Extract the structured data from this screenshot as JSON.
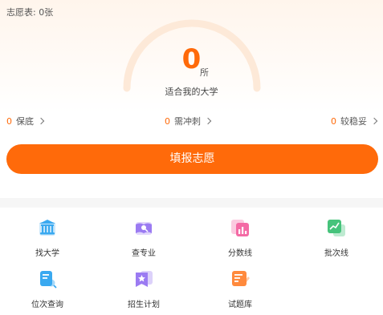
{
  "header": {
    "count_label": "志愿表:",
    "count_value": "0张"
  },
  "summary": {
    "number": "0",
    "unit": "所",
    "caption": "适合我的大学"
  },
  "stats": [
    {
      "value": "0",
      "label": "保底"
    },
    {
      "value": "0",
      "label": "需冲刺"
    },
    {
      "value": "0",
      "label": "较稳妥"
    }
  ],
  "main_button": "填报志愿",
  "grid": [
    {
      "label": "找大学",
      "icon": "university-icon",
      "color": "#3aa9f0"
    },
    {
      "label": "查专业",
      "icon": "book-icon",
      "color": "#9b7bf2"
    },
    {
      "label": "分数线",
      "icon": "bar-chart-icon",
      "color": "#f46aa5"
    },
    {
      "label": "批次线",
      "icon": "trend-chart-icon",
      "color": "#46c37b"
    },
    {
      "label": "位次查询",
      "icon": "document-search-icon",
      "color": "#3aa9f0"
    },
    {
      "label": "招生计划",
      "icon": "star-flag-icon",
      "color": "#9b7bf2"
    },
    {
      "label": "试题库",
      "icon": "edit-note-icon",
      "color": "#ff8a3d"
    }
  ],
  "colors": {
    "accent": "#ff6a0a"
  }
}
